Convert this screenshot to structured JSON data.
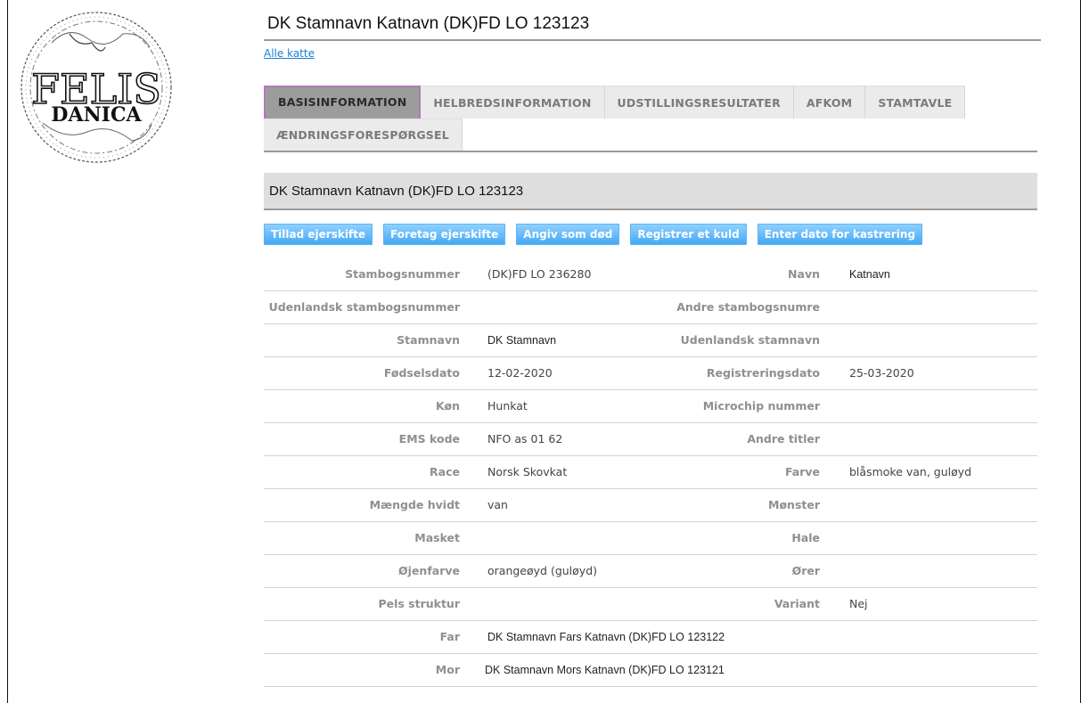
{
  "logo": {
    "line1": "FELIS",
    "line2": "DANICA"
  },
  "page_title": "DK Stamnavn Katnavn (DK)FD LO 123123",
  "breadcrumb": "Alle katte",
  "tabs": [
    "BASISINFORMATION",
    "HELBREDSINFORMATION",
    "UDSTILLINGSRESULTATER",
    "AFKOM",
    "STAMTAVLE",
    "ÆNDRINGSFORESPØRGSEL"
  ],
  "section_title": "DK Stamnavn Katnavn (DK)FD LO 123123",
  "buttons": [
    "Tillad ejerskifte",
    "Foretag ejerskifte",
    "Angiv som død",
    "Registrer et kuld",
    "Enter dato for kastrering"
  ],
  "details": [
    {
      "left_label": "Stambogsnummer",
      "left_value": "(DK)FD LO 236280",
      "right_label": "Navn",
      "right_value": "Katnavn"
    },
    {
      "left_label": "Udenlandsk stambogsnummer",
      "left_value": "",
      "right_label": "Andre stambogsnumre",
      "right_value": ""
    },
    {
      "left_label": "Stamnavn",
      "left_value": "DK Stamnavn",
      "right_label": "Udenlandsk stamnavn",
      "right_value": ""
    },
    {
      "left_label": "Fødselsdato",
      "left_value": "12-02-2020",
      "right_label": "Registreringsdato",
      "right_value": "25-03-2020"
    },
    {
      "left_label": "Køn",
      "left_value": "Hunkat",
      "right_label": "Microchip nummer",
      "right_value": ""
    },
    {
      "left_label": "EMS kode",
      "left_value": "NFO as 01 62",
      "right_label": "Andre titler",
      "right_value": ""
    },
    {
      "left_label": "Race",
      "left_value": "Norsk Skovkat",
      "right_label": "Farve",
      "right_value": "blåsmoke van, guløyd"
    },
    {
      "left_label": "Mængde hvidt",
      "left_value": "van",
      "right_label": "Mønster",
      "right_value": ""
    },
    {
      "left_label": "Masket",
      "left_value": "",
      "right_label": "Hale",
      "right_value": ""
    },
    {
      "left_label": "Øjenfarve",
      "left_value": "orangeøyd (guløyd)",
      "right_label": "Ører",
      "right_value": ""
    },
    {
      "left_label": "Pels struktur",
      "left_value": "",
      "right_label": "Variant",
      "right_value": "Nej"
    },
    {
      "left_label": "Far",
      "left_value": "DK Stamnavn Fars Katnavn (DK)FD LO 123122"
    },
    {
      "left_label": "Mor",
      "left_value": "DK Stamnavn Mors Katnavn (DK)FD LO 123121"
    }
  ]
}
